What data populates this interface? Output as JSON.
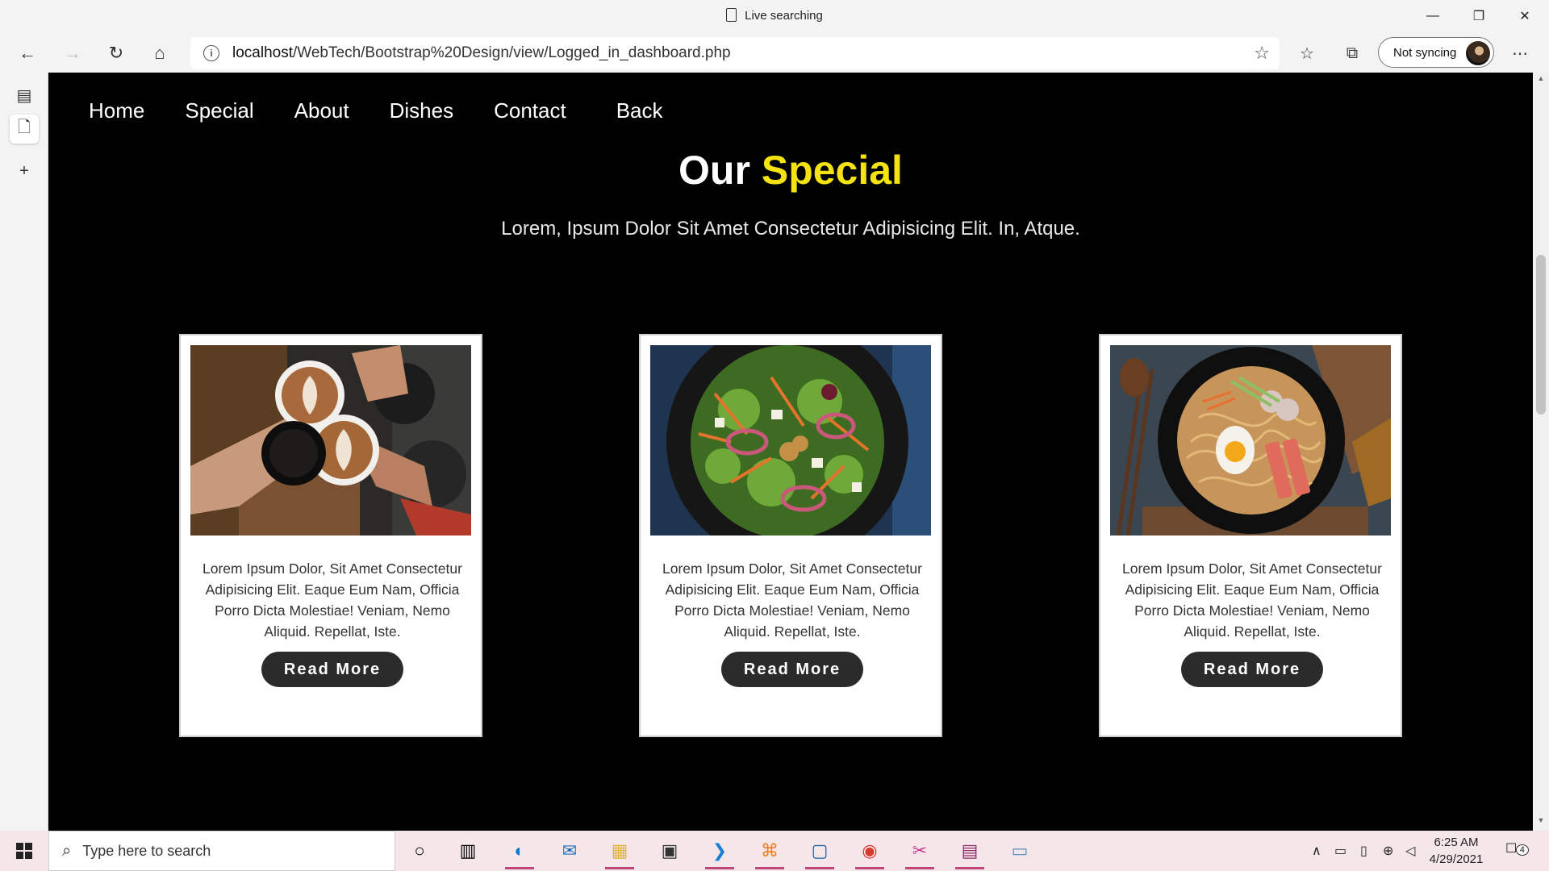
{
  "browser": {
    "tab_title": "Live searching",
    "url_host": "localhost",
    "url_path": "/WebTech/Bootstrap%20Design/view/Logged_in_dashboard.php",
    "sync_label": "Not syncing"
  },
  "site": {
    "nav": [
      "Home",
      "Special",
      "About",
      "Dishes",
      "Contact",
      "Back"
    ],
    "heading_main": "Our",
    "heading_highlight": "Special",
    "subheading": "Lorem, Ipsum Dolor Sit Amet Consectetur Adipisicing Elit. In, Atque.",
    "cards": [
      {
        "image": "coffee-cups-photo",
        "text": "Lorem Ipsum Dolor, Sit Amet Consectetur Adipisicing Elit. Eaque Eum Nam, Officia Porro Dicta Molestiae! Veniam, Nemo Aliquid. Repellat, Iste.",
        "button": "Read More"
      },
      {
        "image": "salad-bowl-photo",
        "text": "Lorem Ipsum Dolor, Sit Amet Consectetur Adipisicing Elit. Eaque Eum Nam, Officia Porro Dicta Molestiae! Veniam, Nemo Aliquid. Repellat, Iste.",
        "button": "Read More"
      },
      {
        "image": "ramen-bowl-photo",
        "text": "Lorem Ipsum Dolor, Sit Amet Consectetur Adipisicing Elit. Eaque Eum Nam, Officia Porro Dicta Molestiae! Veniam, Nemo Aliquid. Repellat, Iste.",
        "button": "Read More"
      }
    ],
    "colors": {
      "highlight": "#f5e211",
      "background": "#000000",
      "button": "#2b2b2b"
    }
  },
  "taskbar": {
    "search_placeholder": "Type here to search",
    "time": "6:25 AM",
    "date": "4/29/2021",
    "notification_count": "4"
  }
}
